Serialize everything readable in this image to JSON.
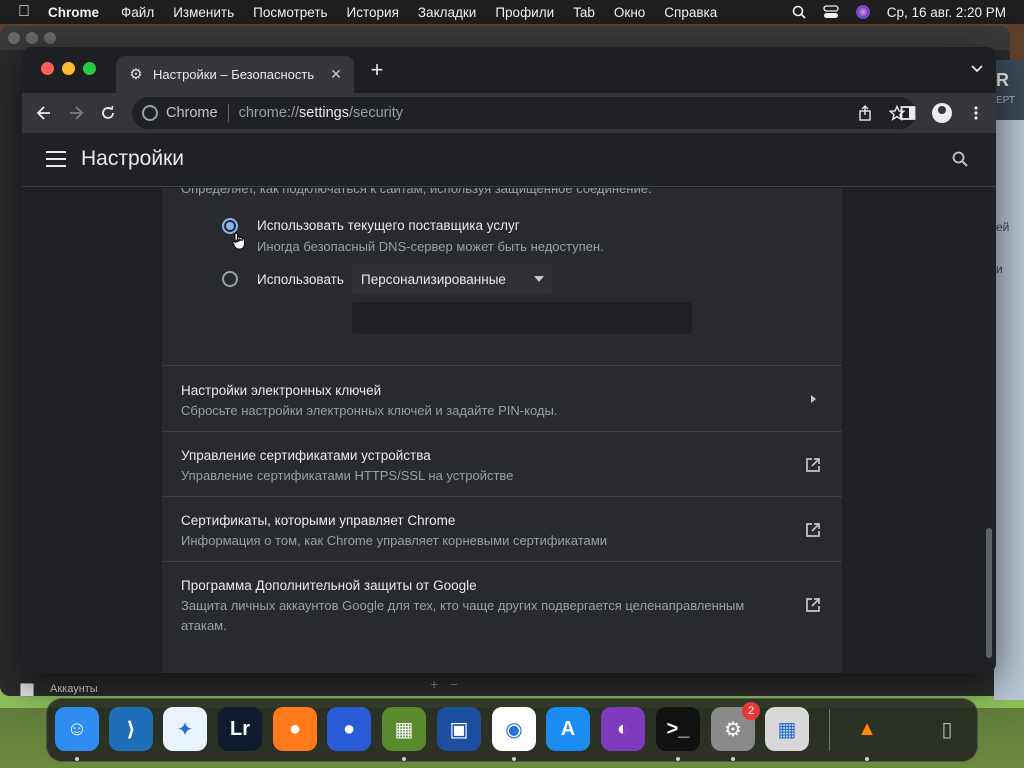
{
  "menubar": {
    "app_name": "Chrome",
    "items": [
      "Файл",
      "Изменить",
      "Посмотреть",
      "История",
      "Закладки",
      "Профили",
      "Tab",
      "Окно",
      "Справка"
    ],
    "clock": "Ср, 16 авг.  2:20 PM"
  },
  "background": {
    "back_window_label": "Аккаунты",
    "right_peek_texts": [
      "R",
      "ЕРТ",
      "ей",
      "и"
    ]
  },
  "tab": {
    "title": "Настройки – Безопасность",
    "close_glyph": "✕",
    "new_tab_glyph": "+"
  },
  "omnibox": {
    "chip": "Chrome",
    "url_scheme": "chrome://",
    "url_host": "settings",
    "url_path": "/security"
  },
  "settings": {
    "title": "Настройки",
    "dns_description": "Определяет, как подключаться к сайтам, используя защищенное соединение.",
    "option_current": {
      "label": "Использовать текущего поставщика услуг",
      "sub": "Иногда безопасный DNS-сервер может быть недоступен.",
      "checked": true
    },
    "option_custom": {
      "label": "Использовать",
      "selected_value": "Персонализированные",
      "checked": false
    },
    "rows": [
      {
        "title": "Настройки электронных ключей",
        "sub": "Сбросьте настройки электронных ключей и задайте PIN-коды.",
        "icon": "chevron-right-icon"
      },
      {
        "title": "Управление сертификатами устройства",
        "sub": "Управление сертификатами HTTPS/SSL на устройстве",
        "icon": "external-link-icon"
      },
      {
        "title": "Сертификаты, которыми управляет Chrome",
        "sub": "Информация о том, как Chrome управляет корневыми сертификатами",
        "icon": "external-link-icon"
      },
      {
        "title": "Программа Дополнительной защиты от Google",
        "sub": "Защита личных аккаунтов Google для тех, кто чаще других подвергается целенаправленным атакам.",
        "icon": "external-link-icon"
      }
    ]
  },
  "dock": {
    "items": [
      {
        "name": "finder",
        "glyph": "☺",
        "bg": "#2f8cf0"
      },
      {
        "name": "vscode",
        "glyph": "⟩",
        "bg": "#1f6fb8"
      },
      {
        "name": "safari",
        "glyph": "✦",
        "bg": "#e9f4ff"
      },
      {
        "name": "lightroom",
        "glyph": "Lr",
        "bg": "#0d1b2e"
      },
      {
        "name": "firefox",
        "glyph": "●",
        "bg": "#ff7a1a"
      },
      {
        "name": "firefox-dev",
        "glyph": "●",
        "bg": "#2a5bd7"
      },
      {
        "name": "minecraft",
        "glyph": "▦",
        "bg": "#5a8a2e"
      },
      {
        "name": "screens",
        "glyph": "▣",
        "bg": "#1c4fa0"
      },
      {
        "name": "chrome",
        "glyph": "◉",
        "bg": "#ffffff"
      },
      {
        "name": "app-store",
        "glyph": "A",
        "bg": "#1b8cf2"
      },
      {
        "name": "github-desktop",
        "glyph": "◐",
        "bg": "#7d3bbd"
      },
      {
        "name": "terminal",
        "glyph": ">_",
        "bg": "#111111"
      },
      {
        "name": "system-settings",
        "glyph": "⚙",
        "bg": "#8a8a8a"
      },
      {
        "name": "launchpad",
        "glyph": "▦",
        "bg": "#d8d8d8"
      },
      {
        "name": "vlc",
        "glyph": "▲",
        "bg": "transparent"
      },
      {
        "name": "trash",
        "glyph": "▯",
        "bg": "transparent"
      }
    ],
    "settings_badge": "2"
  }
}
